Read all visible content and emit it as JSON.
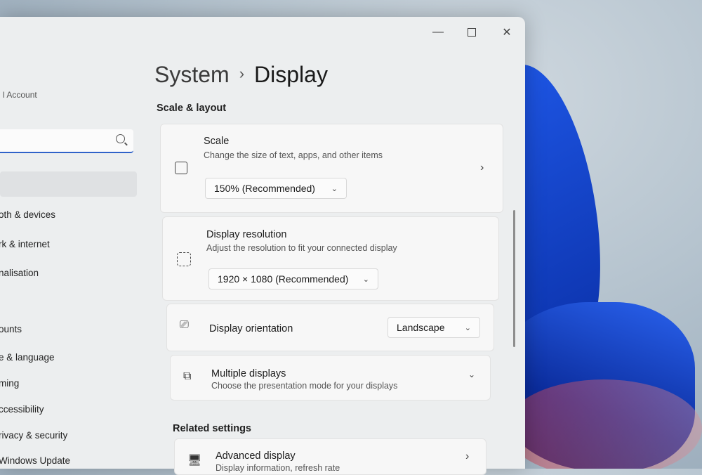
{
  "window": {
    "caption": {
      "minimize_icon": "minimize-icon",
      "maximize_icon": "maximize-icon",
      "close_icon": "close-icon"
    }
  },
  "sidebar": {
    "account_label": "l Account",
    "search": {
      "placeholder": "",
      "icon": "search-icon"
    },
    "items": [
      {
        "label": "oth & devices"
      },
      {
        "label": "rk & internet"
      },
      {
        "label": "nalisation"
      },
      {
        "label": "ounts"
      },
      {
        "label": "e & language"
      },
      {
        "label": "ming"
      },
      {
        "label": "ccessibility"
      },
      {
        "label": "rivacy & security"
      },
      {
        "label": "Windows Update"
      }
    ]
  },
  "header": {
    "parent": "System",
    "separator": "›",
    "current": "Display"
  },
  "sections": {
    "scale_layout": "Scale & layout",
    "related": "Related settings"
  },
  "cards": {
    "scale": {
      "title": "Scale",
      "subtitle": "Change the size of text, apps, and other items",
      "value": "150% (Recommended)",
      "icon": "scale-icon"
    },
    "resolution": {
      "title": "Display resolution",
      "subtitle": "Adjust the resolution to fit your connected display",
      "value": "1920 × 1080 (Recommended)",
      "icon": "resolution-icon"
    },
    "orientation": {
      "title": "Display orientation",
      "value": "Landscape",
      "icon": "orientation-icon"
    },
    "multiple": {
      "title": "Multiple displays",
      "subtitle": "Choose the presentation mode for your displays",
      "icon": "multiple-displays-icon"
    },
    "advanced": {
      "title": "Advanced display",
      "subtitle": "Display information, refresh rate",
      "icon": "monitor-icon"
    }
  },
  "colors": {
    "accent": "#2f62c9",
    "wallpaper_bloom": "#1f58e8"
  }
}
